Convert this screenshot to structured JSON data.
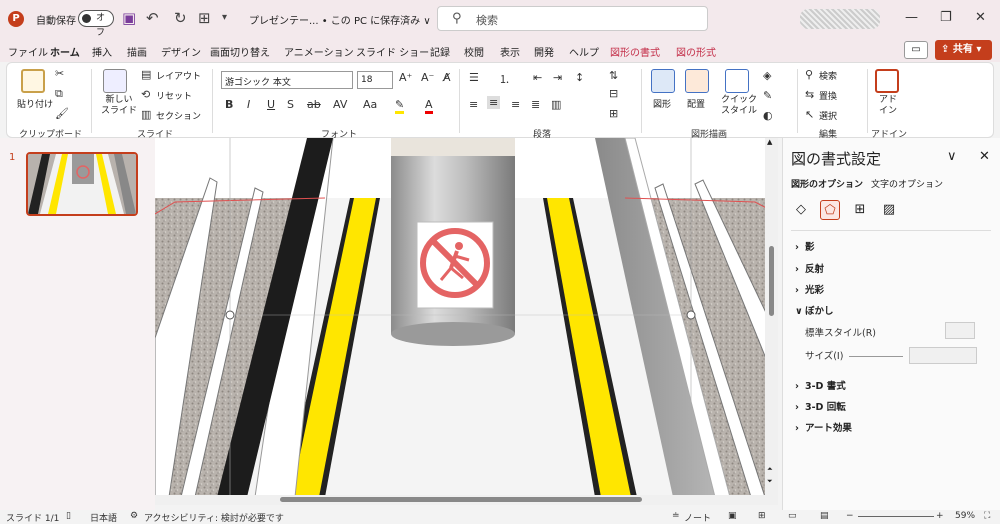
{
  "titlebar": {
    "logo_letter": "P",
    "autosave_label": "自動保存",
    "autosave_state": "オフ",
    "filename": "プレゼンテー... • この PC に保存済み ∨",
    "search_placeholder": "検索"
  },
  "menu": {
    "tabs": [
      "ファイル",
      "ホーム",
      "挿入",
      "描画",
      "デザイン",
      "画面切り替え",
      "アニメーション",
      "スライド ショー",
      "記録",
      "校閲",
      "表示",
      "開発",
      "ヘルプ",
      "図形の書式",
      "図の形式"
    ],
    "active_tab": "ホーム",
    "share_label": "共有"
  },
  "ribbon": {
    "clipboard": {
      "paste": "貼り付け",
      "label": "クリップボード"
    },
    "slides": {
      "new_slide": "新しい\nスライド",
      "layout": "レイアウト",
      "reset": "リセット",
      "section": "セクション",
      "label": "スライド"
    },
    "font": {
      "name": "游ゴシック 本文",
      "size": "18",
      "label": "フォント"
    },
    "paragraph": {
      "label": "段落"
    },
    "drawing": {
      "shape": "図形",
      "arrange": "配置",
      "quick_style": "クイック\nスタイル",
      "label": "図形描画"
    },
    "editing": {
      "find": "検索",
      "replace": "置換",
      "select": "選択",
      "label": "編集"
    },
    "addin": {
      "addin": "アド\nイン",
      "label": "アドイン"
    }
  },
  "slides_panel": {
    "slide_number": "1"
  },
  "format_pane": {
    "title": "図の書式設定",
    "tab_shape": "図形のオプション",
    "tab_text": "文字のオプション",
    "sections": [
      "影",
      "反射",
      "光彩",
      "ぼかし",
      "3-D 書式",
      "3-D 回転",
      "アート効果"
    ],
    "blur_preset_label": "標準スタイル(R)",
    "blur_size_label": "サイズ(I)"
  },
  "statusbar": {
    "slide_info": "スライド 1/1",
    "language": "日本語",
    "accessibility": "アクセシビリティ: 検討が必要です",
    "notes": "ノート",
    "zoom": "59%"
  },
  "colors": {
    "accent": "#c43e1c",
    "yellow_line": "#ffe600",
    "titlebar_bg": "#f3e9ec"
  }
}
